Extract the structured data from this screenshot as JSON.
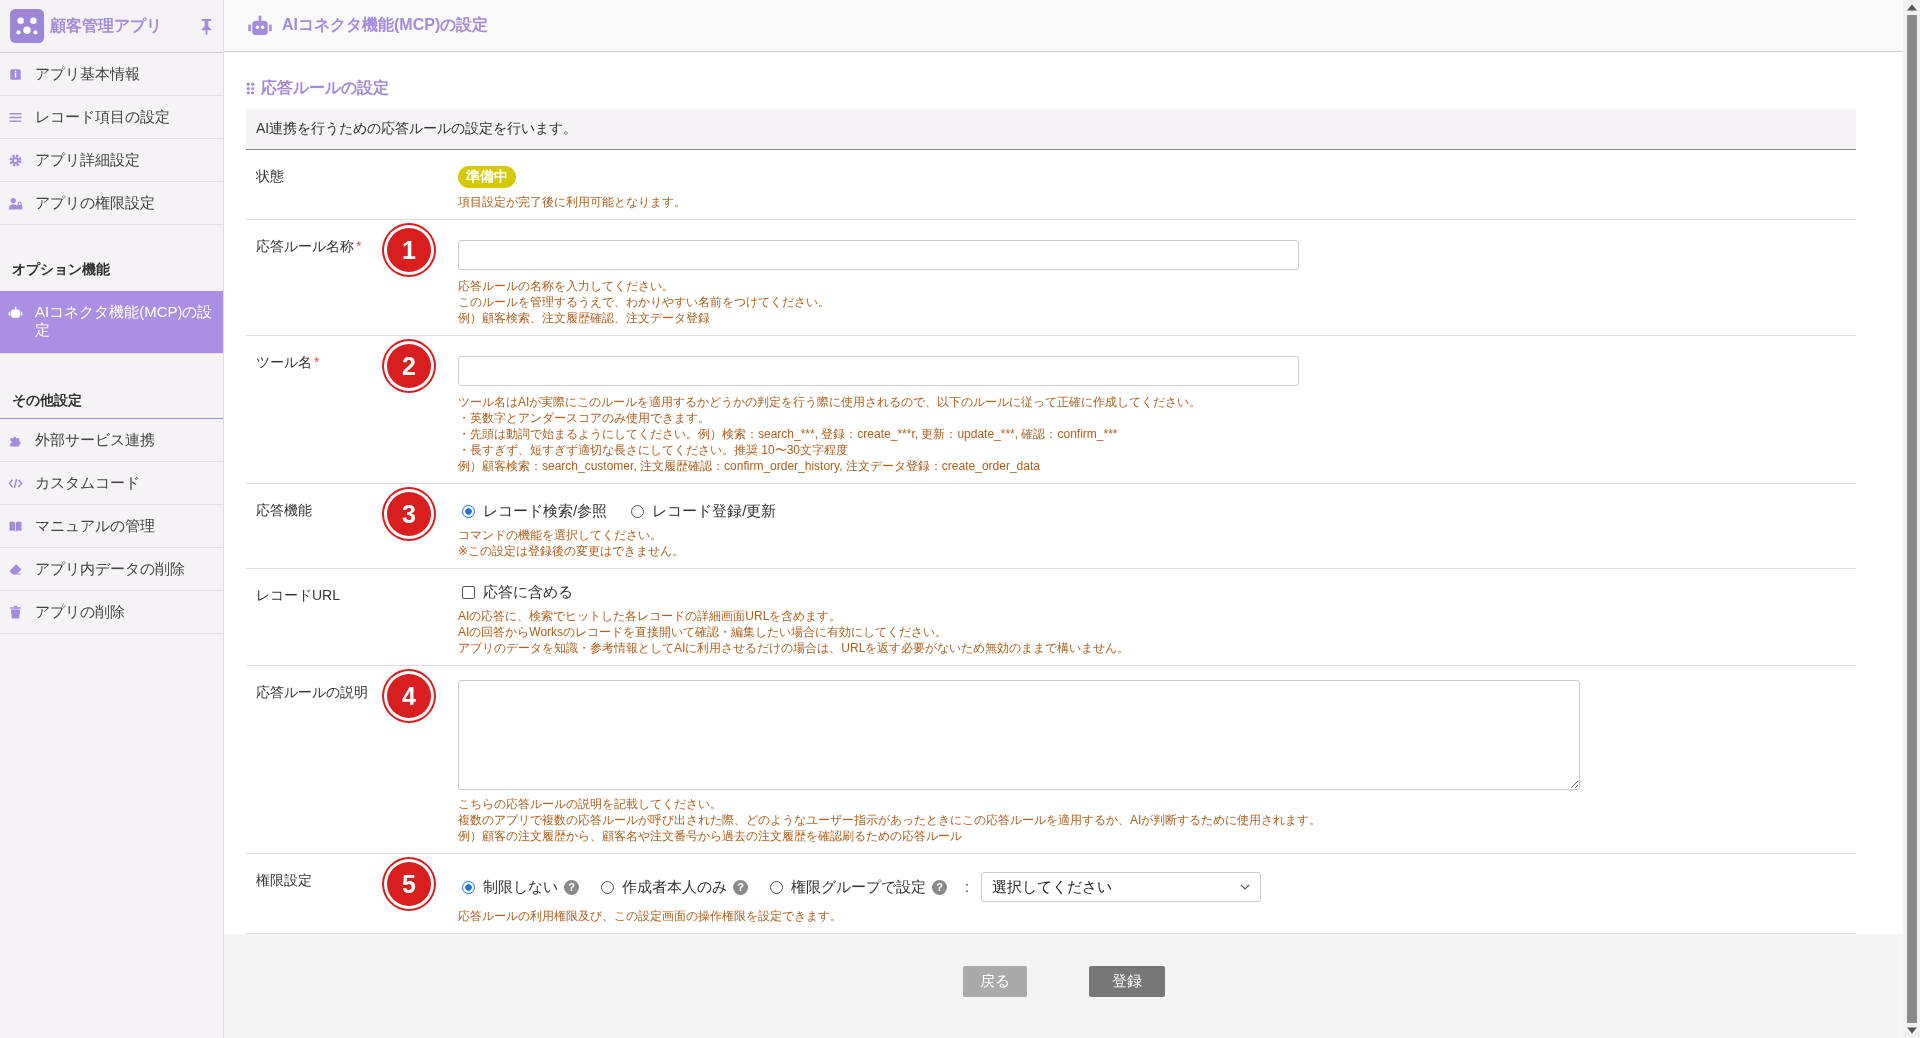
{
  "app": {
    "name": "顧客管理アプリ"
  },
  "sidebar": {
    "groups": [
      {
        "items": [
          {
            "label": "アプリ基本情報",
            "selected": false
          },
          {
            "label": "レコード項目の設定",
            "selected": false
          },
          {
            "label": "アプリ詳細設定",
            "selected": false
          },
          {
            "label": "アプリの権限設定",
            "selected": false
          }
        ]
      },
      {
        "heading": "オプション機能",
        "items": [
          {
            "label": "AIコネクタ機能(MCP)の設定",
            "selected": true
          }
        ]
      },
      {
        "heading": "その他設定",
        "items": [
          {
            "label": "外部サービス連携",
            "selected": false
          },
          {
            "label": "カスタムコード",
            "selected": false
          },
          {
            "label": "マニュアルの管理",
            "selected": false
          },
          {
            "label": "アプリ内データの削除",
            "selected": false
          },
          {
            "label": "アプリの削除",
            "selected": false
          }
        ]
      }
    ]
  },
  "header": {
    "title": "AIコネクタ機能(MCP)の設定"
  },
  "section": {
    "title": "応答ルールの設定",
    "description": "AI連携を行うための応答ルールの設定を行います。"
  },
  "fields": [
    {
      "kind": "badge",
      "label": "状態",
      "badge": "準備中",
      "notes": [
        "項目設定が完了後に利用可能となります。"
      ]
    },
    {
      "kind": "text",
      "label": "応答ルール名称",
      "required_mark": "*",
      "marker": "1",
      "notes": [
        "応答ルールの名称を入力してください。",
        "このルールを管理するうえで、わかりやすい名前をつけてください。",
        "例）顧客検索、注文履歴確認、注文データ登録"
      ]
    },
    {
      "kind": "text",
      "label": "ツール名",
      "required_mark": "*",
      "marker": "2",
      "notes": [
        "ツール名はAIが実際にこのルールを適用するかどうかの判定を行う際に使用されるので、以下のルールに従って正確に作成してください。",
        "・英数字とアンダースコアのみ使用できます。",
        "・先頭は動詞で始まるようにしてください。例）検索：search_***, 登録：create_***r, 更新：update_***, 確認：confirm_***",
        "・長すぎず、短すぎず適切な長さにしてください。推奨 10〜30文字程度",
        "例）顧客検索：search_customer, 注文履歴確認：confirm_order_history, 注文データ登録：create_order_data"
      ]
    },
    {
      "kind": "radio",
      "label": "応答機能",
      "marker": "3",
      "options": [
        {
          "label": "レコード検索/参照",
          "selected": true
        },
        {
          "label": "レコード登録/更新",
          "selected": false
        }
      ],
      "notes": [
        "コマンドの機能を選択してください。",
        "※この設定は登録後の変更はできません。"
      ]
    },
    {
      "kind": "checkbox",
      "label": "レコードURL",
      "option": {
        "label": "応答に含める",
        "checked": false
      },
      "notes": [
        "AIの応答に、検索でヒットした各レコードの詳細画面URLを含めます。",
        "AIの回答からWorksのレコードを直接開いて確認・編集したい場合に有効にしてください。",
        "アプリのデータを知識・参考情報としてAIに利用させるだけの場合は、URLを返す必要がないため無効のままで構いません。"
      ]
    },
    {
      "kind": "textarea",
      "label": "応答ルールの説明",
      "marker": "4",
      "notes": [
        "こちらの応答ルールの説明を記載してください。",
        "複数のアプリで複数の応答ルールが呼び出された際、どのようなユーザー指示があったときにこの応答ルールを適用するか、AIが判断するために使用されます。",
        "例）顧客の注文履歴から、顧客名や注文番号から過去の注文履歴を確認刷るための応答ルール"
      ]
    },
    {
      "kind": "permission",
      "label": "権限設定",
      "marker": "5",
      "options": [
        {
          "label": "制限しない",
          "selected": true,
          "help": "?"
        },
        {
          "label": "作成者本人のみ",
          "selected": false,
          "help": "?"
        },
        {
          "label": "権限グループで設定",
          "selected": false,
          "help": "?"
        }
      ],
      "separator": ":",
      "select": {
        "placeholder": "選択してください"
      },
      "notes": [
        "応答ルールの利用権限及び、この設定画面の操作権限を設定できます。"
      ]
    }
  ],
  "buttons": [
    {
      "label": "戻る",
      "kind": "secondary"
    },
    {
      "label": "登録",
      "kind": "primary"
    }
  ]
}
